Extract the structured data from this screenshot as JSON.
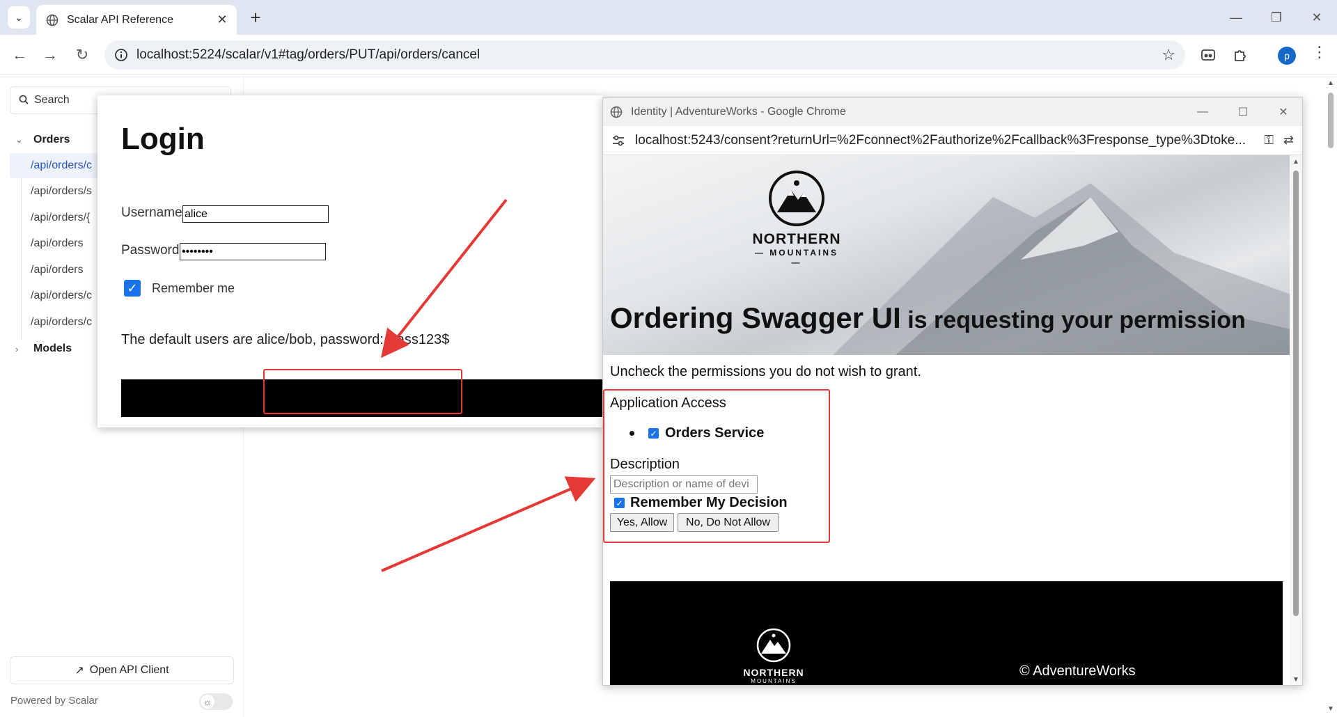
{
  "browser": {
    "tab_title": "Scalar API Reference",
    "tab_close": "✕",
    "new_tab": "+",
    "url": "localhost:5224/scalar/v1#tag/orders/PUT/api/orders/cancel",
    "profile_initial": "p",
    "window_controls": [
      "—",
      "❐",
      "✕"
    ]
  },
  "sidebar": {
    "search_placeholder": "Search",
    "groups": [
      {
        "label": "Orders",
        "expanded": true
      },
      {
        "label": "Models",
        "expanded": false
      }
    ],
    "items": [
      {
        "label": "/api/orders/c",
        "active": true
      },
      {
        "label": "/api/orders/s"
      },
      {
        "label": "/api/orders/{"
      },
      {
        "label": "/api/orders"
      },
      {
        "label": "/api/orders"
      },
      {
        "label": "/api/orders/c"
      },
      {
        "label": "/api/orders/c"
      }
    ],
    "open_api_client": "Open API Client",
    "powered_by": "Powered by Scalar"
  },
  "login": {
    "title": "Login",
    "username_label": "Username",
    "username_value": "alice",
    "password_label": "Password",
    "password_value": "••••••••",
    "remember_label": "Remember me",
    "remember_checked": true,
    "hint": "The default users are alice/bob, password: Pass123$"
  },
  "popup": {
    "window_title": "Identity | AdventureWorks - Google Chrome",
    "url": "localhost:5243/consent?returnUrl=%2Fconnect%2Fauthorize%2Fcallback%3Fresponse_type%3Dtoke...",
    "logo_brand": "NORTHERN",
    "logo_sub": "— MOUNTAINS —",
    "heading_main": "Ordering Swagger UI",
    "heading_rest": " is requesting your permission",
    "instruction": "Uncheck the permissions you do not wish to grant.",
    "application_access": "Application Access",
    "scope_label": "Orders Service",
    "scope_checked": true,
    "description_label": "Description",
    "description_placeholder": "Description or name of devi",
    "remember_decision": "Remember My Decision",
    "remember_checked": true,
    "allow_button": "Yes, Allow",
    "deny_button": "No, Do Not Allow",
    "footer_brand": "NORTHERN",
    "footer_sub": "MOUNTAINS",
    "copyright": "© AdventureWorks"
  },
  "colors": {
    "accent": "#1a73e8",
    "annotation_red": "#e53935",
    "tabstrip_bg": "#dfe6f2"
  }
}
